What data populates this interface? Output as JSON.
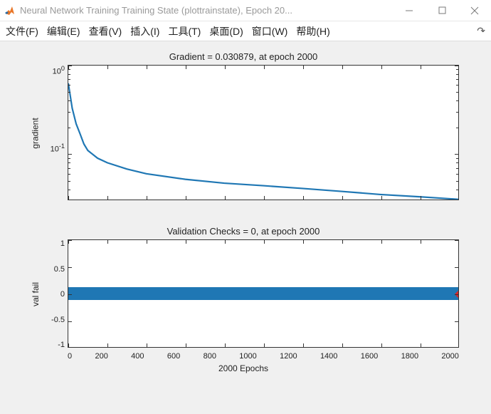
{
  "window": {
    "title": "Neural Network Training Training State (plottrainstate), Epoch 20..."
  },
  "menu": {
    "file": "文件(F)",
    "edit": "编辑(E)",
    "view": "查看(V)",
    "insert": "插入(I)",
    "tools": "工具(T)",
    "desktop": "桌面(D)",
    "window": "窗口(W)",
    "help": "帮助(H)"
  },
  "chart_data": [
    {
      "type": "line",
      "title": "Gradient = 0.030879, at epoch 2000",
      "ylabel": "gradient",
      "yscale": "log",
      "xlim": [
        0,
        2000
      ],
      "ylim": [
        0.03,
        1
      ],
      "xticks": [
        0,
        200,
        400,
        600,
        800,
        1000,
        1200,
        1400,
        1600,
        1800,
        2000
      ],
      "yticks_labels": [
        "10^0",
        "10^-1"
      ],
      "series": [
        {
          "name": "gradient",
          "color": "#1f77b4",
          "x": [
            0,
            20,
            40,
            60,
            80,
            100,
            150,
            200,
            300,
            400,
            600,
            800,
            1000,
            1200,
            1400,
            1600,
            1800,
            2000
          ],
          "values": [
            0.63,
            0.33,
            0.22,
            0.17,
            0.13,
            0.11,
            0.09,
            0.08,
            0.068,
            0.06,
            0.052,
            0.047,
            0.044,
            0.041,
            0.038,
            0.035,
            0.033,
            0.0309
          ]
        }
      ]
    },
    {
      "type": "line",
      "title": "Validation Checks = 0, at epoch 2000",
      "ylabel": "val fail",
      "xlabel": "2000 Epochs",
      "xlim": [
        0,
        2000
      ],
      "ylim": [
        -1,
        1
      ],
      "xticks": [
        0,
        200,
        400,
        600,
        800,
        1000,
        1200,
        1400,
        1600,
        1800,
        2000
      ],
      "yticks": [
        -1,
        -0.5,
        0,
        0.5,
        1
      ],
      "series": [
        {
          "name": "val fail",
          "color": "#1f77b4",
          "constant_value": 0
        }
      ],
      "markers": [
        {
          "x": 2000,
          "y": 0,
          "shape": "diamond",
          "color": "#d62728"
        }
      ]
    }
  ]
}
